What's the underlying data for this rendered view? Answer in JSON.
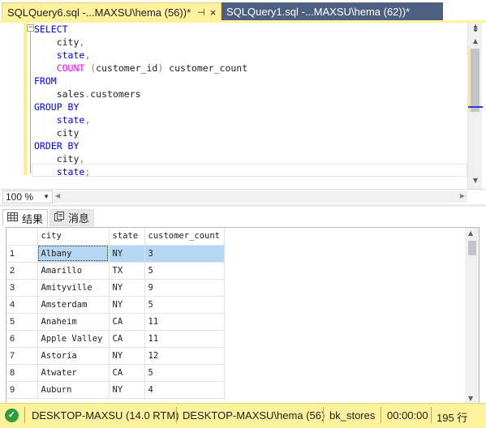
{
  "tabs": [
    {
      "title": "SQLQuery6.sql -...MAXSU\\hema (56))*",
      "pin": "⊣",
      "close": "×"
    },
    {
      "title": "SQLQuery1.sql -...MAXSU\\hema (62))*"
    }
  ],
  "editor": {
    "lines": [
      [
        {
          "t": "SELECT",
          "c": "kw"
        }
      ],
      [
        {
          "t": "    city",
          "c": "id"
        },
        {
          "t": ",",
          "c": "gr"
        }
      ],
      [
        {
          "t": "    state",
          "c": "kw"
        },
        {
          "t": ",",
          "c": "gr"
        }
      ],
      [
        {
          "t": "    COUNT",
          "c": "fn"
        },
        {
          "t": " (",
          "c": "gr"
        },
        {
          "t": "customer_id",
          "c": "id"
        },
        {
          "t": ")",
          "c": "gr"
        },
        {
          "t": " customer_count",
          "c": "id"
        }
      ],
      [
        {
          "t": "FROM",
          "c": "kw"
        }
      ],
      [
        {
          "t": "    sales",
          "c": "id"
        },
        {
          "t": ".",
          "c": "gr"
        },
        {
          "t": "customers",
          "c": "id"
        }
      ],
      [
        {
          "t": "GROUP BY",
          "c": "kw"
        }
      ],
      [
        {
          "t": "    state",
          "c": "kw"
        },
        {
          "t": ",",
          "c": "gr"
        }
      ],
      [
        {
          "t": "    city",
          "c": "id"
        }
      ],
      [
        {
          "t": "ORDER BY",
          "c": "kw"
        }
      ],
      [
        {
          "t": "    city",
          "c": "id"
        },
        {
          "t": ",",
          "c": "gr"
        }
      ],
      [
        {
          "t": "    state",
          "c": "kw"
        },
        {
          "t": ";",
          "c": "gr"
        }
      ]
    ],
    "split_icon": "⇟"
  },
  "zoom": {
    "value": "100 %"
  },
  "results": {
    "tabs": [
      {
        "label": "结果",
        "icon": "grid-icon"
      },
      {
        "label": "消息",
        "icon": "messages-icon"
      }
    ],
    "columns": [
      "city",
      "state",
      "customer_count"
    ],
    "rows": [
      [
        "1",
        "Albany",
        "NY",
        "3"
      ],
      [
        "2",
        "Amarillo",
        "TX",
        "5"
      ],
      [
        "3",
        "Amityville",
        "NY",
        "9"
      ],
      [
        "4",
        "Amsterdam",
        "NY",
        "5"
      ],
      [
        "5",
        "Anaheim",
        "CA",
        "11"
      ],
      [
        "6",
        "Apple Valley",
        "CA",
        "11"
      ],
      [
        "7",
        "Astoria",
        "NY",
        "12"
      ],
      [
        "8",
        "Atwater",
        "CA",
        "5"
      ],
      [
        "9",
        "Auburn",
        "NY",
        "4"
      ]
    ],
    "selected_row": 0
  },
  "status": {
    "icon": "success-check-icon",
    "server": "DESKTOP-MAXSU (14.0 RTM)",
    "user": "DESKTOP-MAXSU\\hema (56)",
    "database": "bk_stores",
    "elapsed": "00:00:00",
    "rows": "195 行"
  },
  "colors": {
    "active_tab": "#fff29d",
    "inactive_tab": "#4d6082",
    "keyword": "#0000ff",
    "function": "#ff00ff",
    "selection": "#b5d7f3"
  }
}
